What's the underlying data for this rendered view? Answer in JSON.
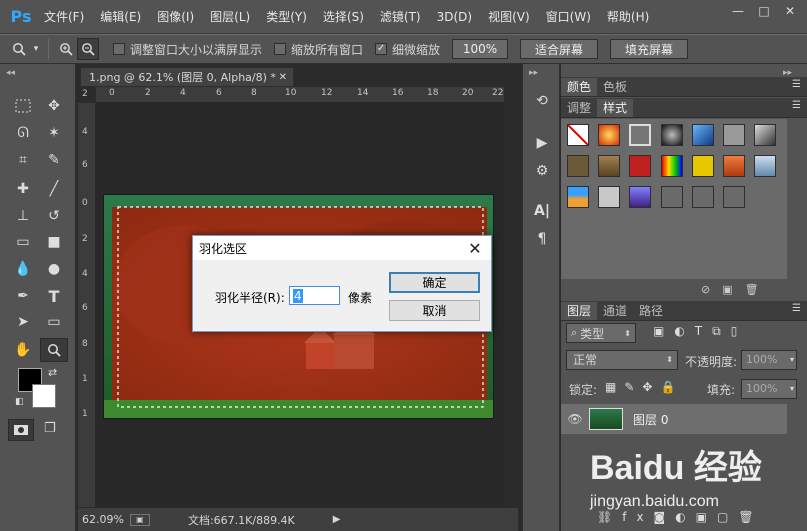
{
  "app": {
    "logo": "Ps"
  },
  "menu": [
    "文件(F)",
    "编辑(E)",
    "图像(I)",
    "图层(L)",
    "类型(Y)",
    "选择(S)",
    "滤镜(T)",
    "3D(D)",
    "视图(V)",
    "窗口(W)",
    "帮助(H)"
  ],
  "window_controls": {
    "minimize": "—",
    "maximize": "□",
    "close": "✕"
  },
  "options": {
    "resize_windows_label": "调整窗口大小以满屏显示",
    "zoom_all_label": "缩放所有窗口",
    "scrubby_label": "细微缩放",
    "scrubby_checked": true,
    "zoom_100_label": "100%",
    "fit_screen_label": "适合屏幕",
    "fill_screen_label": "填充屏幕"
  },
  "document": {
    "tab_title": "1.png @ 62.1% (图层 0, Alpha/8) *",
    "ruler_top": [
      "0",
      "2",
      "4",
      "6",
      "8",
      "10",
      "12",
      "14",
      "16",
      "18",
      "20",
      "22"
    ],
    "ruler_left": [
      "2",
      "4",
      "6",
      "8",
      "0",
      "2",
      "4",
      "6",
      "8",
      "1",
      "1"
    ],
    "zoom_status": "62.09%",
    "doc_size": "文档:667.1K/889.4K"
  },
  "panels": {
    "color_tabs": [
      "颜色",
      "色板"
    ],
    "style_tabs": [
      "调整",
      "样式"
    ],
    "layers_tabs": [
      "图层",
      "通道",
      "路径"
    ],
    "filter_kind": "类型",
    "blend_mode": "正常",
    "opacity_label": "不透明度:",
    "opacity_value": "100%",
    "lock_label": "锁定:",
    "fill_label": "填充:",
    "fill_value": "100%",
    "layer_name": "图层 0"
  },
  "dialog": {
    "title": "羽化选区",
    "radius_label": "羽化半径(R):",
    "radius_value": "4",
    "unit": "像素",
    "ok_label": "确定",
    "cancel_label": "取消",
    "close_glyph": "✕"
  },
  "watermark": {
    "brand": "Baidu 经验",
    "url": "jingyan.baidu.com"
  },
  "colors": {
    "accent": "#31a8ff",
    "panel": "#535353",
    "dialog_default": "#3c7fb1"
  }
}
